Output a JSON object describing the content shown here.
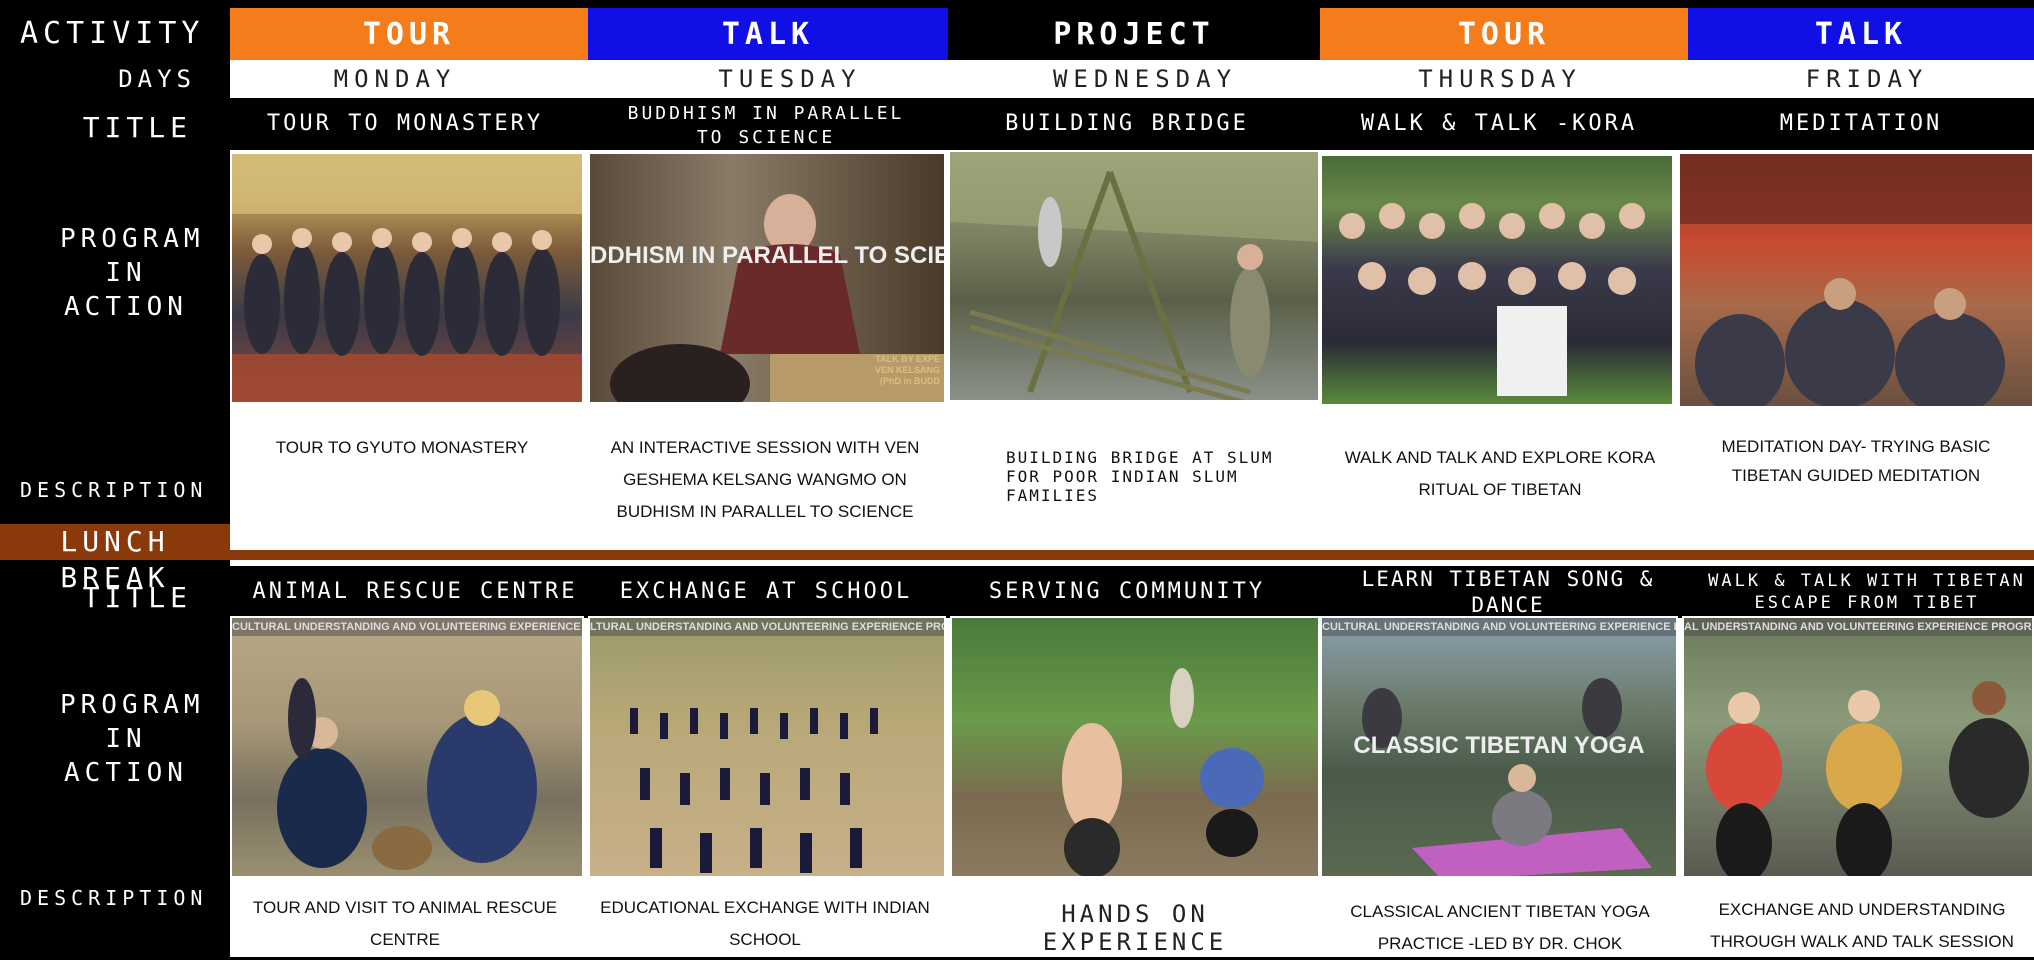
{
  "colors": {
    "tour": "#f47c1a",
    "talk": "#0f0fe6",
    "project": "#000000",
    "lunch": "#8a3a0a"
  },
  "sidebar": {
    "activity": "ACTIVITY",
    "days": "DAYS",
    "title": "TITLE",
    "program": [
      "PROGRAM",
      "IN",
      "ACTION"
    ],
    "description": "DESCRIPTION",
    "lunch_break": "LUNCH BREAK",
    "title2": "TITLE",
    "program2": [
      "PROGRAM",
      "IN",
      "ACTION"
    ],
    "description2": "DESCRIPTION"
  },
  "activities": [
    "TOUR",
    "TALK",
    "PROJECT",
    "TOUR",
    "TALK"
  ],
  "days": [
    "MONDAY",
    "TUESDAY",
    "WEDNESDAY",
    "THURSDAY",
    "FRIDAY"
  ],
  "morning": {
    "titles": [
      "TOUR TO MONASTERY",
      "BUDDHISM IN PARALLEL\nTO SCIENCE",
      "BUILDING BRIDGE",
      "WALK & TALK -KORA",
      "MEDITATION"
    ],
    "photos": [
      "group-at-monastery-photo",
      "nun-talk-photo",
      "bamboo-bridge-photo",
      "kora-group-selfie-photo",
      "meditation-hall-photo"
    ],
    "photo_overlay_text": "DDHISM IN PARALLEL TO SCIENC",
    "photo_caption_small": "TALK BY EXPE\nVEN KELSANG\n(PhD in BUDD",
    "descriptions": [
      "TOUR TO GYUTO MONASTERY",
      "AN INTERACTIVE SESSION WITH VEN GESHEMA  KELSANG WANGMO ON BUDHISM IN PARALLEL  TO SCIENCE",
      "BUILDING BRIDGE AT SLUM FOR POOR INDIAN SLUM FAMILIES",
      "WALK AND  TALK AND EXPLORE KORA RITUAL OF TIBETAN",
      "MEDITATION DAY- TRYING BASIC TIBETAN GUIDED MEDITATION"
    ]
  },
  "afternoon": {
    "titles": [
      "ANIMAL RESCUE CENTRE",
      "EXCHANGE AT SCHOOL",
      "SERVING COMMUNITY",
      "LEARN TIBETAN SONG & DANCE",
      "WALK & TALK WITH TIBETAN\nESCAPE FROM TIBET"
    ],
    "photos": [
      "animal-rescue-photo",
      "school-assembly-photo",
      "digging-community-photo",
      "tibetan-yoga-photo",
      "walk-talk-tibetan-photo"
    ],
    "watermarks": [
      "CULTURAL UNDERSTANDING AND VOLUNTEERING EXPERIENCE PROG",
      "LTURAL UNDERSTANDING AND VOLUNTEERING EXPERIENCE PRO",
      "",
      "CULTURAL UNDERSTANDING AND VOLUNTEERING EXPERIENCE P",
      "AL UNDERSTANDING AND VOLUNTEERING EXPERIENCE PROGRAM"
    ],
    "yoga_overlay": "CLASSIC TIBETAN YOGA",
    "descriptions": [
      "TOUR AND VISIT TO ANIMAL RESCUE CENTRE",
      "EDUCATIONAL EXCHANGE WITH INDIAN SCHOOL",
      "HANDS ON EXPERIENCE",
      "CLASSICAL ANCIENT TIBETAN YOGA PRACTICE -LED BY DR. CHOK",
      "EXCHANGE AND UNDERSTANDING THROUGH WALK AND TALK SESSION"
    ]
  }
}
